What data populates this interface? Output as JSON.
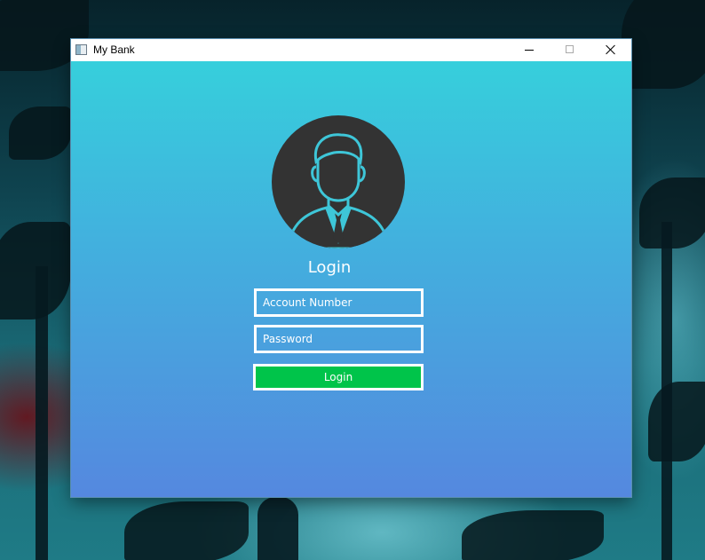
{
  "window": {
    "title": "My Bank",
    "icon": "app-window-icon",
    "controls": [
      "minimize-icon",
      "maximize-icon",
      "close-icon"
    ]
  },
  "login": {
    "heading": "Login",
    "avatar_icon": "user-avatar-icon",
    "account_field": {
      "value": "",
      "placeholder": "Account Number"
    },
    "password_field": {
      "value": "",
      "placeholder": "Password"
    },
    "submit_label": "Login"
  },
  "colors": {
    "gradient_top": "#36cfdc",
    "gradient_bottom": "#5588df",
    "avatar_fill": "#333333",
    "button_green": "#00c44a",
    "field_border": "#ffffff"
  }
}
